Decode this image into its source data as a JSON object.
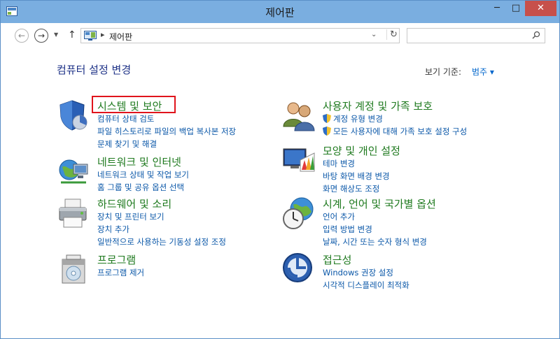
{
  "window": {
    "title": "제어판"
  },
  "window_controls": {
    "minimize": "─",
    "maximize": "□",
    "close": "✕"
  },
  "address": {
    "path": "제어판",
    "separator": "▸",
    "search_placeholder": ""
  },
  "main": {
    "heading": "컴퓨터 설정 변경",
    "view_by_label": "보기 기준:",
    "view_by_value": "범주 ▾"
  },
  "categories": [
    {
      "title": "시스템 및 보안",
      "icon": "shield-icon",
      "links": [
        "컴퓨터 상태 검토",
        "파일 히스토리로 파일의 백업 복사본 저장",
        "문제 찾기 및 해결"
      ]
    },
    {
      "title": "네트워크 및 인터넷",
      "icon": "network-globe-icon",
      "links": [
        "네트워크 상태 및 작업 보기",
        "홈 그룹 및 공유 옵션 선택"
      ]
    },
    {
      "title": "하드웨어 및 소리",
      "icon": "printer-icon",
      "links": [
        "장치 및 프린터 보기",
        "장치 추가",
        "일반적으로 사용하는 기동성 설정 조정"
      ]
    },
    {
      "title": "프로그램",
      "icon": "programs-icon",
      "links": [
        "프로그램 제거"
      ]
    },
    {
      "title": "사용자 계정 및 가족 보호",
      "icon": "users-icon",
      "links": [
        "계정 유형 변경",
        "모든 사용자에 대해 가족 보호 설정 구성"
      ]
    },
    {
      "title": "모양 및 개인 설정",
      "icon": "appearance-icon",
      "links": [
        "테마 변경",
        "바탕 화면 배경 변경",
        "화면 해상도 조정"
      ]
    },
    {
      "title": "시계, 언어 및 국가별 옵션",
      "icon": "clock-globe-icon",
      "links": [
        "언어 추가",
        "입력 방법 변경",
        "날짜, 시간 또는 숫자 형식 변경"
      ]
    },
    {
      "title": "접근성",
      "icon": "accessibility-icon",
      "links": [
        "Windows 권장 설정",
        "시각적 디스플레이 최적화"
      ]
    }
  ],
  "colors": {
    "titlebar": "#7aaee0",
    "category_title": "#1f7a1f",
    "link": "#0a57a8",
    "heading": "#1e3287",
    "highlight": "#e0141c"
  }
}
